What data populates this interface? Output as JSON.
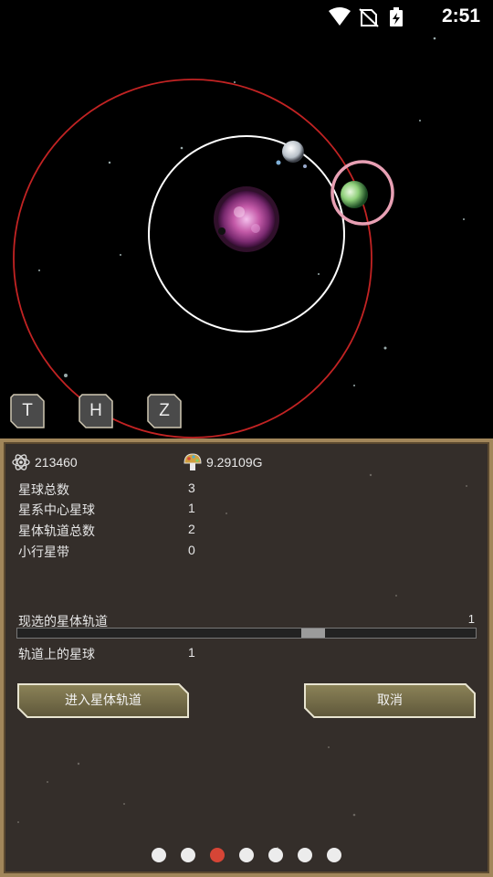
{
  "status_bar": {
    "time": "2:51",
    "icons": [
      "wifi-icon",
      "no-sim-icon",
      "battery-charging-icon"
    ]
  },
  "controls": {
    "keys": [
      "T",
      "H",
      "Z"
    ]
  },
  "resources": {
    "primary_value": "213460",
    "primary_icon": "atom-icon",
    "secondary_value": "9.29109G",
    "secondary_icon": "mushroom-icon"
  },
  "stats": [
    {
      "label": "星球总数",
      "value": "3"
    },
    {
      "label": "星系中心星球",
      "value": "1"
    },
    {
      "label": "星体轨道总数",
      "value": "2"
    },
    {
      "label": "小行星带",
      "value": "0"
    }
  ],
  "orbit_selector": {
    "label": "现选的星体轨道",
    "value": "1"
  },
  "planets_on_orbit": {
    "label": "轨道上的星球",
    "value": "1"
  },
  "buttons": {
    "enter_orbit": "进入星体轨道",
    "cancel": "取消"
  },
  "pagination": {
    "count": 7,
    "active_index": 2
  },
  "colors": {
    "panel_bg": "#342e2a",
    "panel_border": "#a1865a",
    "active_dot": "#d64536",
    "outer_orbit": "#c22323",
    "inner_orbit": "#ffffff",
    "selection_ring": "#e8a0b4"
  }
}
